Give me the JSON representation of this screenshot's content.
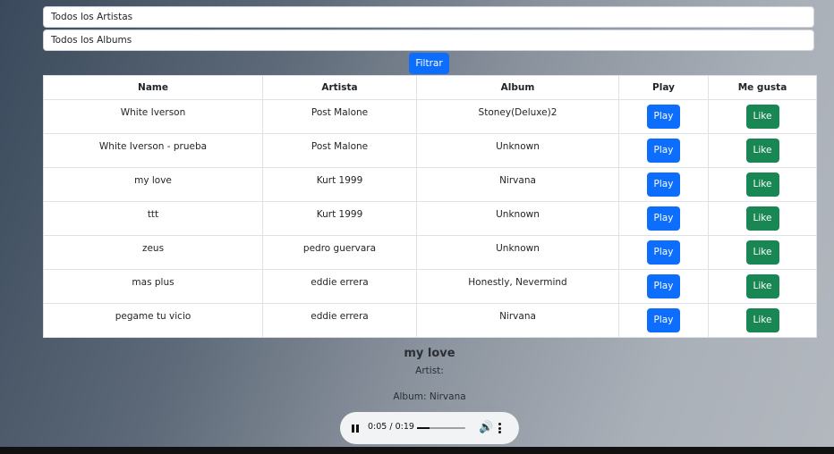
{
  "filters": {
    "artist_value": "Todos los Artistas",
    "album_value": "Todos los Albums",
    "filter_button": "Filtrar"
  },
  "table": {
    "headers": [
      "Name",
      "Artista",
      "Album",
      "Play",
      "Me gusta"
    ],
    "rows": [
      {
        "name": "White Iverson",
        "artist": "Post Malone",
        "album": "Stoney(Deluxe)2",
        "play": "Play",
        "like": "Like"
      },
      {
        "name": "White Iverson - prueba",
        "artist": "Post Malone",
        "album": "Unknown",
        "play": "Play",
        "like": "Like"
      },
      {
        "name": "my love",
        "artist": "Kurt 1999",
        "album": "Nirvana",
        "play": "Play",
        "like": "Like"
      },
      {
        "name": "ttt",
        "artist": "Kurt 1999",
        "album": "Unknown",
        "play": "Play",
        "like": "Like"
      },
      {
        "name": "zeus",
        "artist": "pedro guervara",
        "album": "Unknown",
        "play": "Play",
        "like": "Like"
      },
      {
        "name": "mas plus",
        "artist": "eddie errera",
        "album": "Honestly, Nevermind",
        "play": "Play",
        "like": "Like"
      },
      {
        "name": "pegame tu vicio",
        "artist": "eddie errera",
        "album": "Nirvana",
        "play": "Play",
        "like": "Like"
      }
    ]
  },
  "now_playing": {
    "title": "my love",
    "artist_line": "Artist:",
    "album_line": "Album: Nirvana"
  },
  "player": {
    "time": "0:05 / 0:19",
    "progress_fraction": 0.26,
    "state": "playing"
  },
  "colors": {
    "primary": "#0d6efd",
    "success": "#198754"
  }
}
